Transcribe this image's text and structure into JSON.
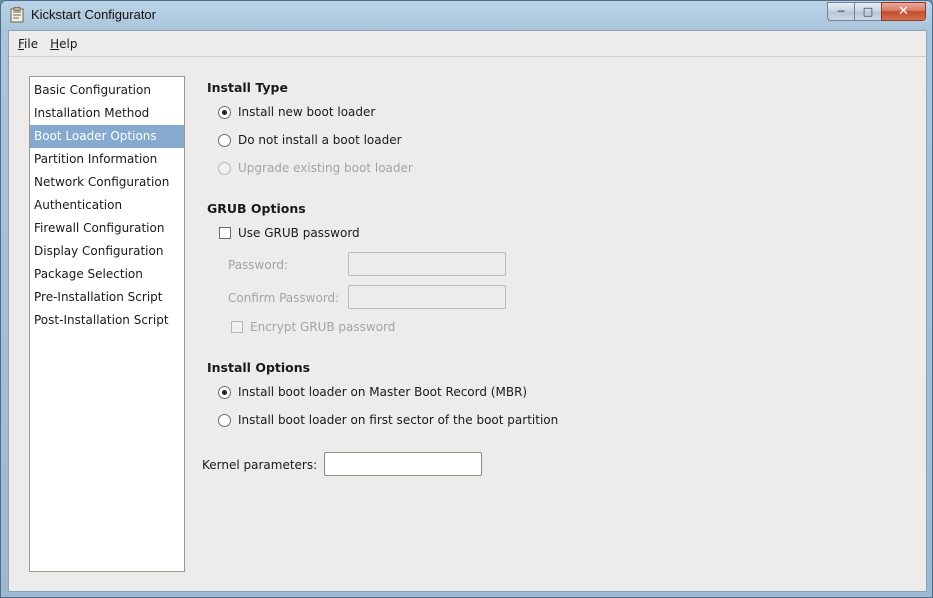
{
  "window": {
    "title": "Kickstart Configurator"
  },
  "menu": {
    "file": {
      "mnemonic": "F",
      "rest": "ile"
    },
    "help": {
      "mnemonic": "H",
      "rest": "elp"
    }
  },
  "sidebar": {
    "items": [
      "Basic Configuration",
      "Installation Method",
      "Boot Loader Options",
      "Partition Information",
      "Network Configuration",
      "Authentication",
      "Firewall Configuration",
      "Display Configuration",
      "Package Selection",
      "Pre-Installation Script",
      "Post-Installation Script"
    ],
    "selected": "Boot Loader Options"
  },
  "install_type": {
    "title": "Install Type",
    "options": [
      {
        "label": "Install new boot loader",
        "checked": true,
        "enabled": true
      },
      {
        "label": "Do not install a boot loader",
        "checked": false,
        "enabled": true
      },
      {
        "label": "Upgrade existing boot loader",
        "checked": false,
        "enabled": false
      }
    ]
  },
  "grub_options": {
    "title": "GRUB Options",
    "use_password_label": "Use GRUB password",
    "password_label": "Password:",
    "confirm_label": "Confirm Password:",
    "encrypt_label": "Encrypt GRUB password"
  },
  "install_options": {
    "title": "Install Options",
    "options": [
      {
        "label": "Install boot loader on Master Boot Record (MBR)",
        "checked": true
      },
      {
        "label": "Install boot loader on first sector of the boot partition",
        "checked": false
      }
    ]
  },
  "kernel": {
    "label": "Kernel parameters:",
    "value": ""
  },
  "colors": {
    "selection": "#86a9d0",
    "background": "#edecea"
  }
}
